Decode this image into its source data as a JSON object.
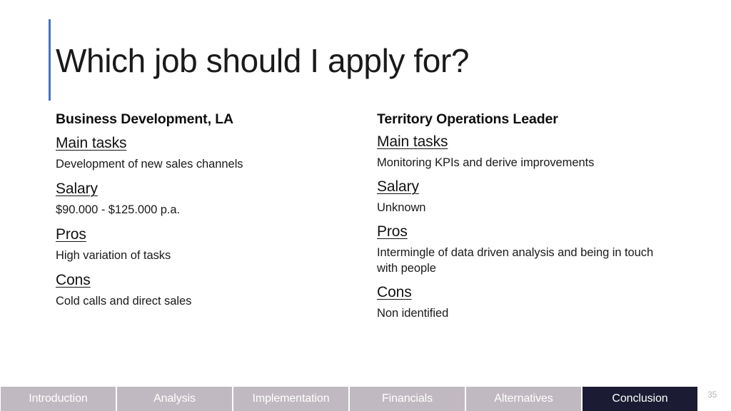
{
  "slide": {
    "title": "Which job should I apply for?",
    "accent_color": "#4472c4",
    "background_color": "#ffffff",
    "page_number": "35"
  },
  "columns": [
    {
      "job_title": "Business Development, LA",
      "fields": [
        {
          "label": "Main tasks",
          "value": "Development of new sales channels"
        },
        {
          "label": "Salary",
          "value": "$90.000 - $125.000 p.a."
        },
        {
          "label": "Pros",
          "value": "High variation of tasks"
        },
        {
          "label": "Cons",
          "value": "Cold calls and direct sales"
        }
      ]
    },
    {
      "job_title": "Territory Operations Leader",
      "fields": [
        {
          "label": "Main tasks",
          "value": "Monitoring KPIs and derive improvements"
        },
        {
          "label": "Salary",
          "value": "Unknown"
        },
        {
          "label": "Pros",
          "value": "Intermingle of data driven analysis and being in touch with people"
        },
        {
          "label": "Cons",
          "value": "Non identified"
        }
      ]
    }
  ],
  "bottom_nav": {
    "active_index": 5,
    "inactive_color": "#c1b9c1",
    "active_color": "#1b1b33",
    "text_color": "#ffffff",
    "tabs": [
      {
        "label": "Introduction"
      },
      {
        "label": "Analysis"
      },
      {
        "label": "Implementation"
      },
      {
        "label": "Financials"
      },
      {
        "label": "Alternatives"
      },
      {
        "label": "Conclusion"
      }
    ]
  }
}
